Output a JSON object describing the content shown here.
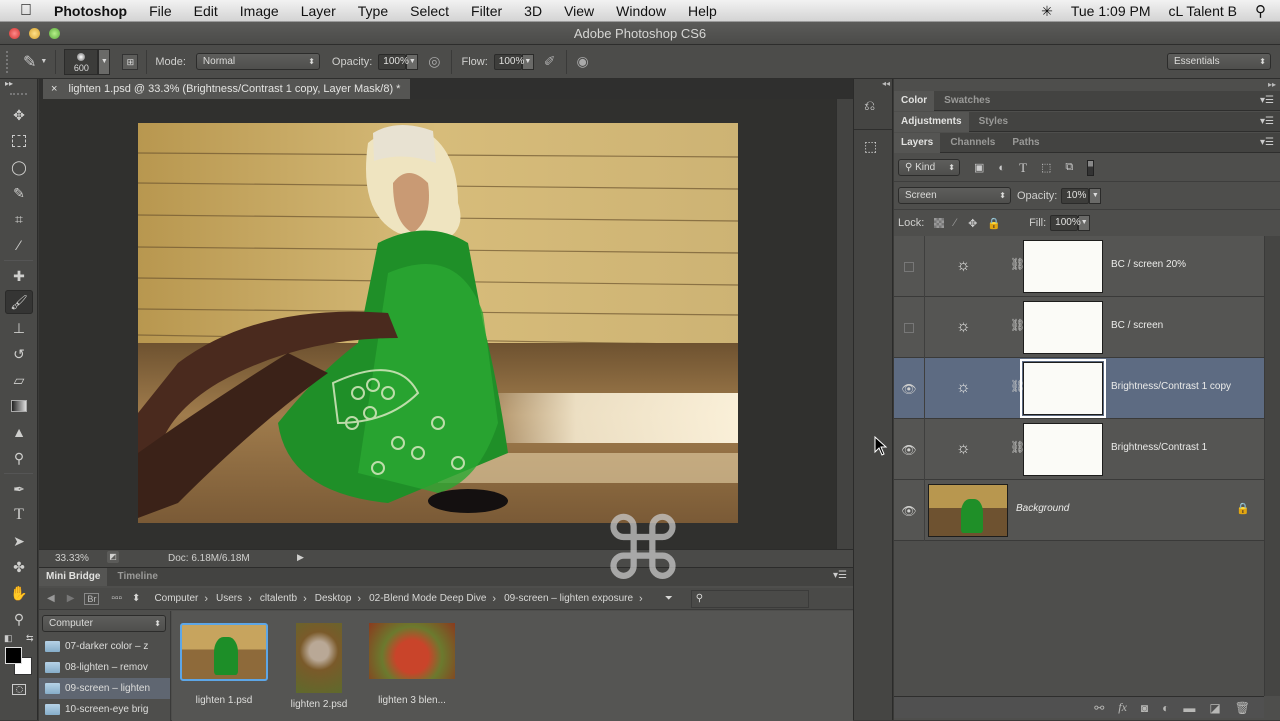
{
  "menubar": {
    "app": "Photoshop",
    "items": [
      "File",
      "Edit",
      "Image",
      "Layer",
      "Type",
      "Select",
      "Filter",
      "3D",
      "View",
      "Window",
      "Help"
    ],
    "clock": "Tue 1:09 PM",
    "user": "cL Talent B"
  },
  "window": {
    "title": "Adobe Photoshop CS6"
  },
  "options": {
    "brush_size": "600",
    "mode_label": "Mode:",
    "mode_value": "Normal",
    "opacity_label": "Opacity:",
    "opacity_value": "100%",
    "flow_label": "Flow:",
    "flow_value": "100%",
    "workspace": "Essentials"
  },
  "document": {
    "tab_title": "lighten 1.psd @ 33.3% (Brightness/Contrast 1 copy, Layer Mask/8) *",
    "zoom": "33.33%",
    "doc_size": "Doc: 6.18M/6.18M"
  },
  "minibridge": {
    "tabs": [
      "Mini Bridge",
      "Timeline"
    ],
    "br_label": "Br",
    "breadcrumbs": [
      "Computer",
      "Users",
      "cltalentb",
      "Desktop",
      "02-Blend Mode Deep Dive",
      "09-screen – lighten exposure"
    ],
    "location": "Computer",
    "folders": [
      "07-darker color – z",
      "08-lighten – remov",
      "09-screen – lighten",
      "10-screen-eye brig"
    ],
    "selected_folder": 2,
    "files": [
      "lighten 1.psd",
      "lighten 2.psd",
      "lighten 3 blen..."
    ]
  },
  "panels": {
    "group1_tabs": [
      "Color",
      "Swatches"
    ],
    "group2_tabs": [
      "Adjustments",
      "Styles"
    ],
    "group3_tabs": [
      "Layers",
      "Channels",
      "Paths"
    ],
    "filter_kind": "Kind",
    "blend_mode": "Screen",
    "opacity_label": "Opacity:",
    "opacity_value": "10%",
    "lock_label": "Lock:",
    "fill_label": "Fill:",
    "fill_value": "100%"
  },
  "layers": [
    {
      "name": "BC / screen 20%",
      "visible": false,
      "selected": false
    },
    {
      "name": "BC / screen",
      "visible": false,
      "selected": false
    },
    {
      "name": "Brightness/Contrast 1 copy",
      "visible": true,
      "selected": true
    },
    {
      "name": "Brightness/Contrast 1",
      "visible": true,
      "selected": false
    },
    {
      "name": "Background",
      "visible": true,
      "selected": false,
      "locked": true
    }
  ],
  "overlay": {
    "command_key": "⌘"
  }
}
